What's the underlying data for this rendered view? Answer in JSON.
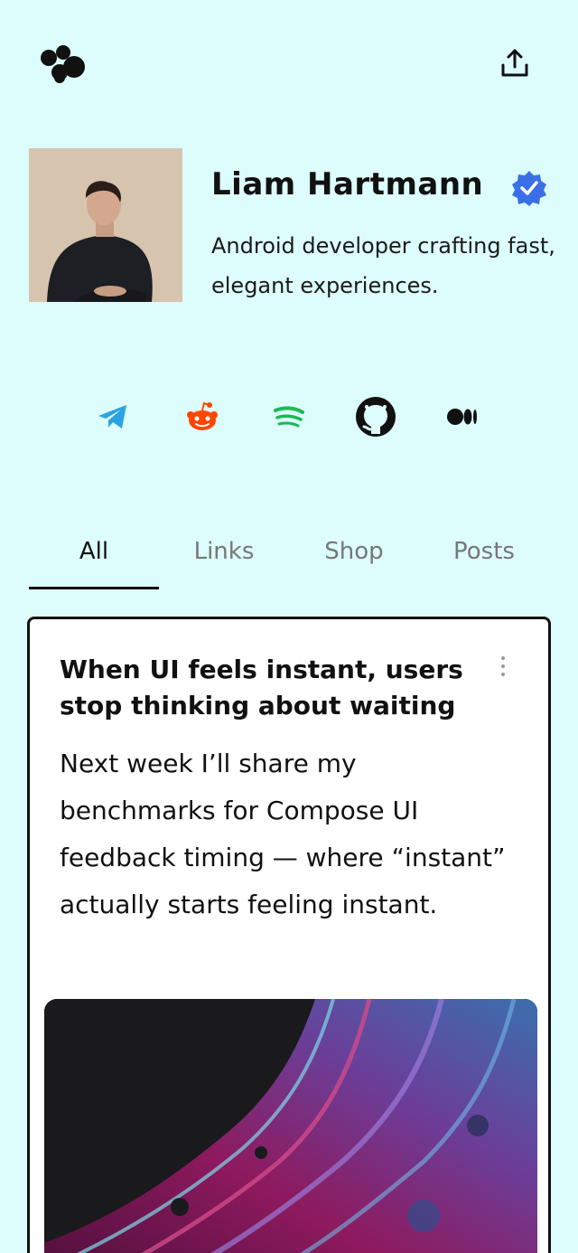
{
  "profile": {
    "name": "Liam Hartmann",
    "bio": "Android developer crafting fast, elegant experiences.",
    "verified_icon": "verified-badge-icon"
  },
  "header": {
    "logo_icon": "app-logo-icon",
    "share_icon": "share-icon"
  },
  "socials": [
    {
      "name": "telegram",
      "icon": "telegram-icon",
      "color": "#2aa3e0"
    },
    {
      "name": "reddit",
      "icon": "reddit-icon",
      "color": "#ff4500"
    },
    {
      "name": "spotify",
      "icon": "spotify-icon",
      "color": "#1db954"
    },
    {
      "name": "github",
      "icon": "github-icon",
      "color": "#111111"
    },
    {
      "name": "medium",
      "icon": "medium-icon",
      "color": "#111111"
    }
  ],
  "tabs": [
    {
      "label": "All",
      "active": true
    },
    {
      "label": "Links",
      "active": false
    },
    {
      "label": "Shop",
      "active": false
    },
    {
      "label": "Posts",
      "active": false
    }
  ],
  "post": {
    "title": "When UI feels instant, users stop thinking about waiting",
    "body": "Next week I’ll share my benchmarks for Compose UI feedback timing — where “instant” actually starts feeling instant."
  },
  "colors": {
    "background": "#dcfdfb",
    "verified": "#3b6fe6",
    "text": "#111111"
  }
}
